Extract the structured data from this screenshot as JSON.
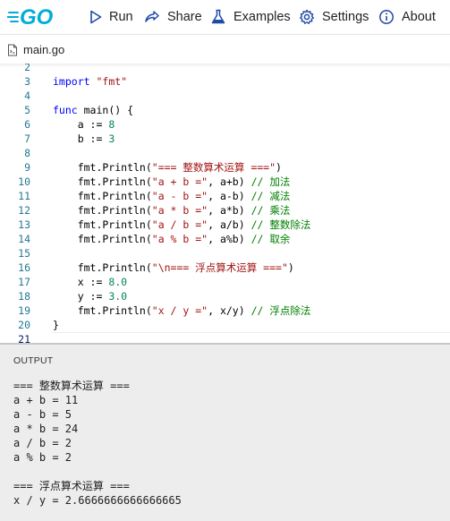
{
  "header": {
    "logo_text": "GO",
    "nav": [
      {
        "label": "Run",
        "icon": "play-icon"
      },
      {
        "label": "Share",
        "icon": "share-icon"
      },
      {
        "label": "Examples",
        "icon": "flask-icon"
      },
      {
        "label": "Settings",
        "icon": "gear-icon"
      },
      {
        "label": "About",
        "icon": "info-icon"
      }
    ]
  },
  "tab": {
    "filename": "main.go",
    "icon": "file-icon"
  },
  "editor": {
    "current_line": 21,
    "lines": [
      {
        "n": "2",
        "tokens": []
      },
      {
        "n": "3",
        "tokens": [
          {
            "t": "import",
            "c": "kw"
          },
          {
            "t": " ",
            "c": "pl"
          },
          {
            "t": "\"fmt\"",
            "c": "str"
          }
        ]
      },
      {
        "n": "4",
        "tokens": []
      },
      {
        "n": "5",
        "tokens": [
          {
            "t": "func",
            "c": "kw"
          },
          {
            "t": " main() {",
            "c": "pl"
          }
        ]
      },
      {
        "n": "6",
        "tokens": [
          {
            "t": "    a := ",
            "c": "pl"
          },
          {
            "t": "8",
            "c": "num"
          }
        ]
      },
      {
        "n": "7",
        "tokens": [
          {
            "t": "    b := ",
            "c": "pl"
          },
          {
            "t": "3",
            "c": "num"
          }
        ]
      },
      {
        "n": "8",
        "tokens": []
      },
      {
        "n": "9",
        "tokens": [
          {
            "t": "    fmt.Println(",
            "c": "pl"
          },
          {
            "t": "\"=== 整数算术运算 ===\"",
            "c": "str"
          },
          {
            "t": ")",
            "c": "pl"
          }
        ]
      },
      {
        "n": "10",
        "tokens": [
          {
            "t": "    fmt.Println(",
            "c": "pl"
          },
          {
            "t": "\"a + b =\"",
            "c": "str"
          },
          {
            "t": ", a+b) ",
            "c": "pl"
          },
          {
            "t": "// 加法",
            "c": "cm"
          }
        ]
      },
      {
        "n": "11",
        "tokens": [
          {
            "t": "    fmt.Println(",
            "c": "pl"
          },
          {
            "t": "\"a - b =\"",
            "c": "str"
          },
          {
            "t": ", a-b) ",
            "c": "pl"
          },
          {
            "t": "// 减法",
            "c": "cm"
          }
        ]
      },
      {
        "n": "12",
        "tokens": [
          {
            "t": "    fmt.Println(",
            "c": "pl"
          },
          {
            "t": "\"a * b =\"",
            "c": "str"
          },
          {
            "t": ", a*b) ",
            "c": "pl"
          },
          {
            "t": "// 乘法",
            "c": "cm"
          }
        ]
      },
      {
        "n": "13",
        "tokens": [
          {
            "t": "    fmt.Println(",
            "c": "pl"
          },
          {
            "t": "\"a / b =\"",
            "c": "str"
          },
          {
            "t": ", a/b) ",
            "c": "pl"
          },
          {
            "t": "// 整数除法",
            "c": "cm"
          }
        ]
      },
      {
        "n": "14",
        "tokens": [
          {
            "t": "    fmt.Println(",
            "c": "pl"
          },
          {
            "t": "\"a % b =\"",
            "c": "str"
          },
          {
            "t": ", a%b) ",
            "c": "pl"
          },
          {
            "t": "// 取余",
            "c": "cm"
          }
        ]
      },
      {
        "n": "15",
        "tokens": []
      },
      {
        "n": "16",
        "tokens": [
          {
            "t": "    fmt.Println(",
            "c": "pl"
          },
          {
            "t": "\"\\n=== 浮点算术运算 ===\"",
            "c": "str"
          },
          {
            "t": ")",
            "c": "pl"
          }
        ]
      },
      {
        "n": "17",
        "tokens": [
          {
            "t": "    x := ",
            "c": "pl"
          },
          {
            "t": "8.0",
            "c": "num"
          }
        ]
      },
      {
        "n": "18",
        "tokens": [
          {
            "t": "    y := ",
            "c": "pl"
          },
          {
            "t": "3.0",
            "c": "num"
          }
        ]
      },
      {
        "n": "19",
        "tokens": [
          {
            "t": "    fmt.Println(",
            "c": "pl"
          },
          {
            "t": "\"x / y =\"",
            "c": "str"
          },
          {
            "t": ", x/y) ",
            "c": "pl"
          },
          {
            "t": "// 浮点除法",
            "c": "cm"
          }
        ]
      },
      {
        "n": "20",
        "tokens": [
          {
            "t": "}",
            "c": "pl"
          }
        ]
      },
      {
        "n": "21",
        "tokens": []
      }
    ]
  },
  "output": {
    "label": "OUTPUT",
    "lines": [
      "=== 整数算术运算 ===",
      "a + b = 11",
      "a - b = 5",
      "a * b = 24",
      "a / b = 2",
      "a % b = 2",
      "",
      "=== 浮点算术运算 ===",
      "x / y = 2.6666666666666665"
    ]
  },
  "colors": {
    "go_brand": "#00add8",
    "keyword": "#0000ff",
    "string": "#a31515",
    "number": "#098658",
    "comment": "#008000",
    "line_number": "#237893",
    "output_bg": "#ededed"
  }
}
